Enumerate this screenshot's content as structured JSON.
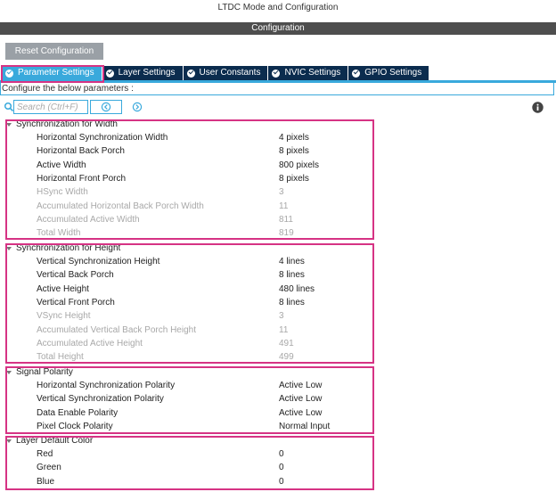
{
  "window": {
    "title": "LTDC Mode and Configuration"
  },
  "config_header": "Configuration",
  "reset_button": "Reset Configuration",
  "tabs": [
    {
      "label": "Parameter Settings",
      "active": true
    },
    {
      "label": "Layer Settings",
      "active": false
    },
    {
      "label": "User Constants",
      "active": false
    },
    {
      "label": "NVIC Settings",
      "active": false
    },
    {
      "label": "GPIO Settings",
      "active": false
    }
  ],
  "configure_text": "Configure the below parameters :",
  "search": {
    "placeholder": "Search (Ctrl+F)"
  },
  "groups": [
    {
      "title": "Synchronization for Width",
      "params": [
        {
          "name": "Horizontal Synchronization Width",
          "value": "4 pixels",
          "enabled": true
        },
        {
          "name": "Horizontal Back Porch",
          "value": "8 pixels",
          "enabled": true
        },
        {
          "name": "Active Width",
          "value": "800 pixels",
          "enabled": true
        },
        {
          "name": "Horizontal Front Porch",
          "value": "8 pixels",
          "enabled": true
        },
        {
          "name": "HSync Width",
          "value": "3",
          "enabled": false
        },
        {
          "name": "Accumulated Horizontal Back Porch Width",
          "value": "11",
          "enabled": false
        },
        {
          "name": "Accumulated Active Width",
          "value": "811",
          "enabled": false
        },
        {
          "name": "Total Width",
          "value": "819",
          "enabled": false
        }
      ]
    },
    {
      "title": "Synchronization for Height",
      "params": [
        {
          "name": "Vertical Synchronization Height",
          "value": "4 lines",
          "enabled": true
        },
        {
          "name": "Vertical Back Porch",
          "value": "8 lines",
          "enabled": true
        },
        {
          "name": "Active Height",
          "value": "480 lines",
          "enabled": true
        },
        {
          "name": "Vertical Front Porch",
          "value": "8 lines",
          "enabled": true
        },
        {
          "name": "VSync Height",
          "value": "3",
          "enabled": false
        },
        {
          "name": "Accumulated Vertical Back Porch Height",
          "value": "11",
          "enabled": false
        },
        {
          "name": "Accumulated Active Height",
          "value": "491",
          "enabled": false
        },
        {
          "name": "Total Height",
          "value": "499",
          "enabled": false
        }
      ]
    },
    {
      "title": "Signal Polarity",
      "params": [
        {
          "name": "Horizontal Synchronization Polarity",
          "value": "Active Low",
          "enabled": true
        },
        {
          "name": "Vertical Synchronization Polarity",
          "value": "Active Low",
          "enabled": true
        },
        {
          "name": "Data Enable Polarity",
          "value": "Active Low",
          "enabled": true
        },
        {
          "name": "Pixel Clock Polarity",
          "value": "Normal Input",
          "enabled": true
        }
      ]
    },
    {
      "title": "Layer Default Color",
      "params": [
        {
          "name": "Red",
          "value": "0",
          "enabled": true
        },
        {
          "name": "Green",
          "value": "0",
          "enabled": true
        },
        {
          "name": "Blue",
          "value": "0",
          "enabled": true
        }
      ]
    }
  ],
  "colors": {
    "tab_active": "#39a9dc",
    "tab_inactive": "#0b2c4e",
    "highlight": "#d63384",
    "header": "#4e4e4e",
    "disabled_text": "#a8a8a8"
  }
}
